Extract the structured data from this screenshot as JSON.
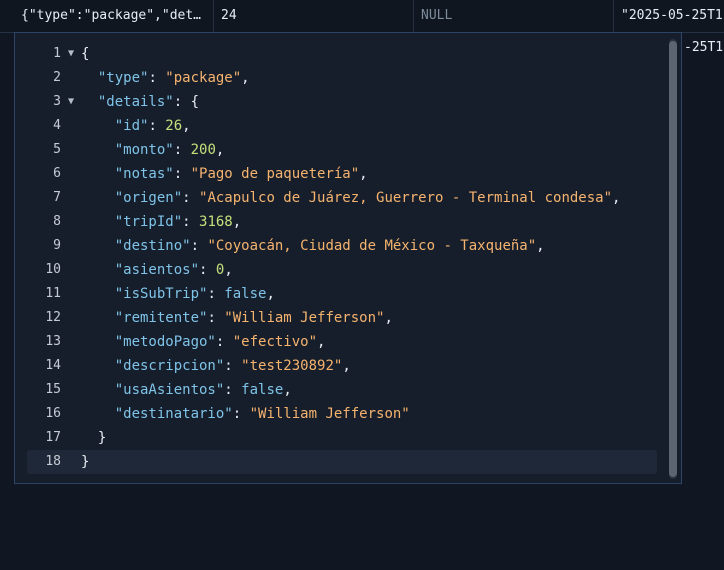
{
  "grid": {
    "row1": {
      "col1": "{\"type\":\"package\",\"det…",
      "col2": "24",
      "col3": "NULL",
      "col4": "\"2025-05-25T1"
    },
    "row2": {
      "col4_partial": "-25T1"
    }
  },
  "editor": {
    "lines": [
      {
        "num": "1",
        "fold": "▼"
      },
      {
        "num": "2",
        "fold": ""
      },
      {
        "num": "3",
        "fold": "▼"
      },
      {
        "num": "4",
        "fold": ""
      },
      {
        "num": "5",
        "fold": ""
      },
      {
        "num": "6",
        "fold": ""
      },
      {
        "num": "7",
        "fold": ""
      },
      {
        "num": "8",
        "fold": ""
      },
      {
        "num": "9",
        "fold": ""
      },
      {
        "num": "10",
        "fold": ""
      },
      {
        "num": "11",
        "fold": ""
      },
      {
        "num": "12",
        "fold": ""
      },
      {
        "num": "13",
        "fold": ""
      },
      {
        "num": "14",
        "fold": ""
      },
      {
        "num": "15",
        "fold": ""
      },
      {
        "num": "16",
        "fold": ""
      },
      {
        "num": "17",
        "fold": ""
      },
      {
        "num": "18",
        "fold": ""
      }
    ],
    "tokens": {
      "open_brace": "{",
      "close_brace": "}",
      "type_key": "\"type\"",
      "type_val": "\"package\"",
      "details_key": "\"details\"",
      "id_key": "\"id\"",
      "id_val": "26",
      "monto_key": "\"monto\"",
      "monto_val": "200",
      "notas_key": "\"notas\"",
      "notas_val": "\"Pago de paquetería\"",
      "origen_key": "\"origen\"",
      "origen_val": "\"Acapulco de Juárez, Guerrero - Terminal condesa\"",
      "tripId_key": "\"tripId\"",
      "tripId_val": "3168",
      "destino_key": "\"destino\"",
      "destino_val": "\"Coyoacán, Ciudad de México - Taxqueña\"",
      "asientos_key": "\"asientos\"",
      "asientos_val": "0",
      "isSubTrip_key": "\"isSubTrip\"",
      "isSubTrip_val": "false",
      "remitente_key": "\"remitente\"",
      "remitente_val": "\"William Jefferson\"",
      "metodoPago_key": "\"metodoPago\"",
      "metodoPago_val": "\"efectivo\"",
      "descripcion_key": "\"descripcion\"",
      "descripcion_val": "\"test230892\"",
      "usaAsientos_key": "\"usaAsientos\"",
      "usaAsientos_val": "false",
      "destinatario_key": "\"destinatario\"",
      "destinatario_val": "\"William Jefferson\""
    }
  },
  "colors": {
    "background": "#101722",
    "editor_bg": "#161e2c",
    "editor_border": "#2c4566",
    "key": "#7fc4e8",
    "string": "#f5b36e",
    "number": "#c4e07a",
    "boolean": "#7fc4e8"
  }
}
